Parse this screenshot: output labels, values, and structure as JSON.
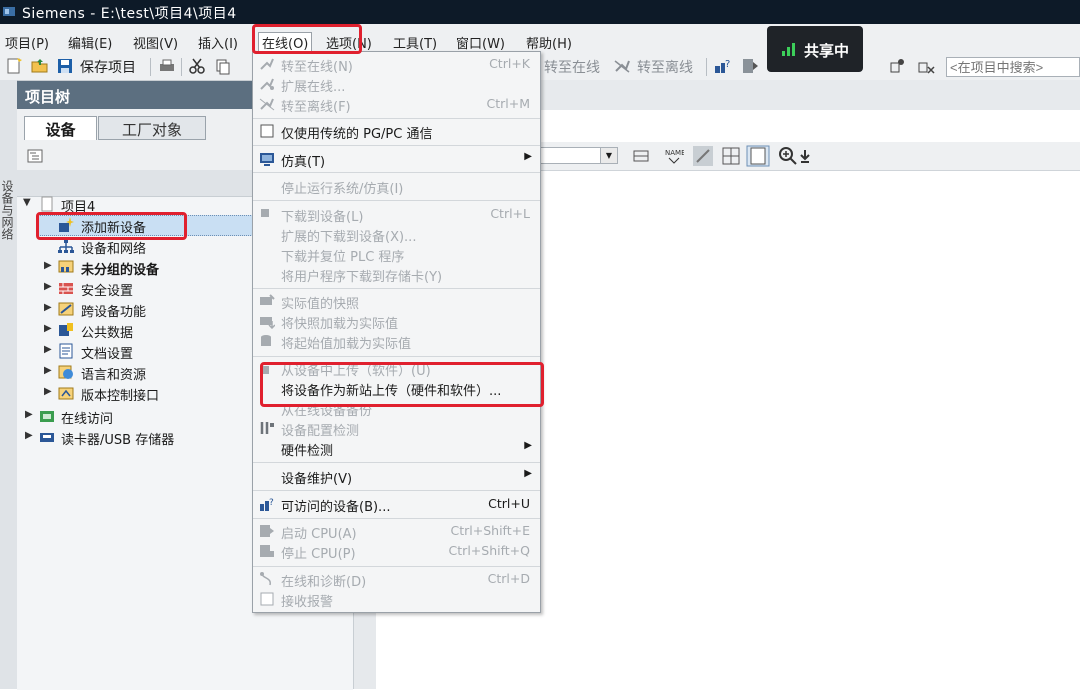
{
  "window": {
    "title": "Siemens  -  E:\\test\\项目4\\项目4"
  },
  "menubar": {
    "items": [
      "项目(P)",
      "编辑(E)",
      "视图(V)",
      "插入(I)",
      "在线(O)",
      "选项(N)",
      "工具(T)",
      "窗口(W)",
      "帮助(H)"
    ]
  },
  "toolbar": {
    "save_label": "保存项目",
    "go_online": "转至在线",
    "go_offline": "转至离线",
    "search_placeholder": "<在项目中搜索>"
  },
  "share": {
    "label": "共享中"
  },
  "side_strip": {
    "label": "设备与网络"
  },
  "project_tree": {
    "title": "项目树",
    "tabs": [
      "设备",
      "工厂对象"
    ],
    "items": [
      {
        "label": "项目4",
        "level": 0,
        "expanded": true
      },
      {
        "label": "添加新设备",
        "level": 1,
        "selected": true
      },
      {
        "label": "设备和网络",
        "level": 1
      },
      {
        "label": "未分组的设备",
        "level": 1,
        "bold": true
      },
      {
        "label": "安全设置",
        "level": 1
      },
      {
        "label": "跨设备功能",
        "level": 1
      },
      {
        "label": "公共数据",
        "level": 1
      },
      {
        "label": "文档设置",
        "level": 1
      },
      {
        "label": "语言和资源",
        "level": 1
      },
      {
        "label": "版本控制接口",
        "level": 1
      },
      {
        "label": "在线访问",
        "level": 0
      },
      {
        "label": "读卡器/USB 存储器",
        "level": 0
      }
    ]
  },
  "online_menu": {
    "items": [
      {
        "label": "转至在线(N)",
        "shortcut": "Ctrl+K",
        "enabled": false
      },
      {
        "label": "扩展在线...",
        "shortcut": "",
        "enabled": false
      },
      {
        "label": "转至离线(F)",
        "shortcut": "Ctrl+M",
        "enabled": false
      },
      {
        "label": "仅使用传统的 PG/PC 通信",
        "shortcut": "",
        "enabled": true
      },
      {
        "label": "仿真(T)",
        "shortcut": "",
        "enabled": true,
        "submenu": true
      },
      {
        "label": "停止运行系统/仿真(I)",
        "shortcut": "",
        "enabled": false
      },
      {
        "label": "下载到设备(L)",
        "shortcut": "Ctrl+L",
        "enabled": false
      },
      {
        "label": "扩展的下载到设备(X)...",
        "shortcut": "",
        "enabled": false
      },
      {
        "label": "下载并复位 PLC 程序",
        "shortcut": "",
        "enabled": false
      },
      {
        "label": "将用户程序下载到存储卡(Y)",
        "shortcut": "",
        "enabled": false
      },
      {
        "label": "实际值的快照",
        "shortcut": "",
        "enabled": false
      },
      {
        "label": "将快照加载为实际值",
        "shortcut": "",
        "enabled": false
      },
      {
        "label": "将起始值加载为实际值",
        "shortcut": "",
        "enabled": false
      },
      {
        "label": "从设备中上传（软件）(U)",
        "shortcut": "",
        "enabled": false
      },
      {
        "label": "将设备作为新站上传（硬件和软件）...",
        "shortcut": "",
        "enabled": true
      },
      {
        "label": "从在线设备备份",
        "shortcut": "",
        "enabled": false
      },
      {
        "label": "设备配置检测",
        "shortcut": "",
        "enabled": false
      },
      {
        "label": "硬件检测",
        "shortcut": "",
        "enabled": true,
        "submenu": true
      },
      {
        "label": "设备维护(V)",
        "shortcut": "",
        "enabled": true,
        "submenu": true
      },
      {
        "label": "可访问的设备(B)...",
        "shortcut": "Ctrl+U",
        "enabled": true
      },
      {
        "label": "启动 CPU(A)",
        "shortcut": "Ctrl+Shift+E",
        "enabled": false
      },
      {
        "label": "停止 CPU(P)",
        "shortcut": "Ctrl+Shift+Q",
        "enabled": false
      },
      {
        "label": "在线和诊断(D)",
        "shortcut": "Ctrl+D",
        "enabled": false
      },
      {
        "label": "接收报警",
        "shortcut": "",
        "enabled": false
      }
    ]
  },
  "colors": {
    "highlight": "#e0202e",
    "title_bg": "#0d1a28",
    "tree_header": "#5c6f80",
    "selection": "#c9dff3"
  }
}
